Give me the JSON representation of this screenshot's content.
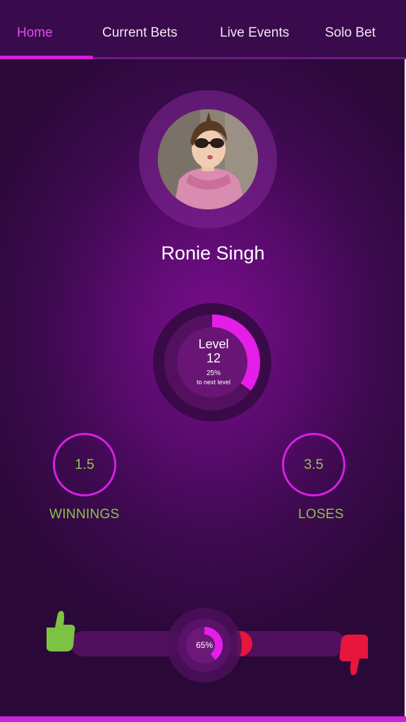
{
  "nav": {
    "tabs": [
      {
        "label": "Home",
        "active": true
      },
      {
        "label": "Current Bets",
        "active": false
      },
      {
        "label": "Live Events",
        "active": false
      },
      {
        "label": "Solo Bet",
        "active": false
      }
    ]
  },
  "profile": {
    "name": "Ronie Singh"
  },
  "level": {
    "label": "Level",
    "number": "12",
    "progress_text": "25%",
    "progress_value": 0.25,
    "next_label": "to next level"
  },
  "stats": {
    "winnings": {
      "value": "1.5",
      "label": "WINNINGS"
    },
    "loses": {
      "value": "3.5",
      "label": "LOSES"
    }
  },
  "ratio": {
    "text": "65%",
    "value": 0.65
  },
  "colors": {
    "accent": "#d61fdc",
    "stat_text": "#8fc24a",
    "thumb_up": "#7cc243",
    "thumb_down": "#e8163c"
  },
  "icons": {
    "thumb_up": "thumbs-up-icon",
    "thumb_down": "thumbs-down-icon"
  }
}
